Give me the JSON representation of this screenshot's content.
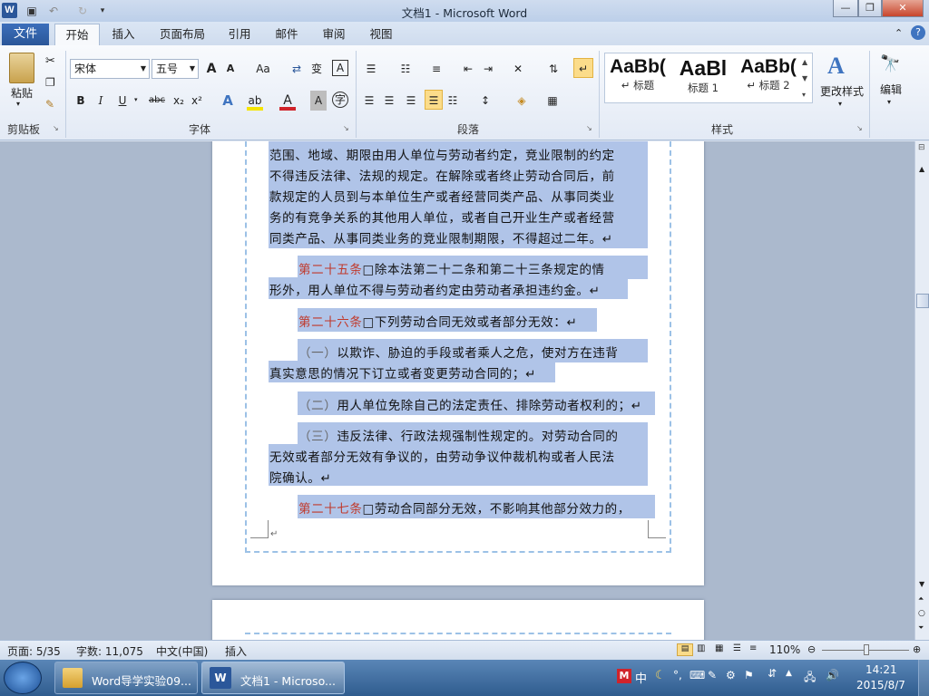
{
  "window": {
    "title": "文档1 - Microsoft Word"
  },
  "tabs": [
    "文件",
    "开始",
    "插入",
    "页面布局",
    "引用",
    "邮件",
    "审阅",
    "视图"
  ],
  "ribbon": {
    "clipboard": {
      "paste": "粘贴",
      "label": "剪贴板"
    },
    "font": {
      "name": "宋体",
      "size": "五号",
      "label": "字体",
      "grow": "A",
      "shrink": "A",
      "case": "Aa",
      "bold": "B",
      "italic": "I",
      "underline": "U",
      "strike": "abc",
      "sub": "x₂",
      "sup": "x²",
      "clear": "A"
    },
    "paragraph": {
      "label": "段落"
    },
    "styles": {
      "label": "样式",
      "items": [
        {
          "preview": "AaBb(",
          "name": "↵ 标题"
        },
        {
          "preview": "AaBl",
          "name": "标题 1"
        },
        {
          "preview": "AaBb(",
          "name": "↵ 标题 2"
        }
      ],
      "change": "更改样式"
    },
    "editing": {
      "label": "编辑"
    }
  },
  "document": {
    "lines": [
      "范围、地域、期限由用人单位与劳动者约定，竞业限制的约定",
      "不得违反法律、法规的规定。在解除或者终止劳动合同后，前",
      "款规定的人员到与本单位生产或者经营同类产品、从事同类业",
      "务的有竞争关系的其他用人单位，或者自己开业生产或者经营",
      "同类产品、从事同类业务的竞业限制期限，不得超过二年。↵"
    ],
    "art25": {
      "num": "第二十五条",
      "rest1": "除本法第二十二条和第二十三条规定的情",
      "line2": "形外，用人单位不得与劳动者约定由劳动者承担违约金。↵"
    },
    "art26": {
      "num": "第二十六条",
      "rest": "下列劳动合同无效或者部分无效：↵"
    },
    "item1": {
      "num": "（一）",
      "rest1": "以欺诈、胁迫的手段或者乘人之危，使对方在违背",
      "line2": "真实意思的情况下订立或者变更劳动合同的；↵"
    },
    "item2": {
      "num": "（二）",
      "rest": "用人单位免除自己的法定责任、排除劳动者权利的；↵"
    },
    "item3": {
      "num": "（三）",
      "rest1": "违反法律、行政法规强制性规定的。对劳动合同的",
      "line2": "无效或者部分无效有争议的，由劳动争议仲裁机构或者人民法",
      "line3": "院确认。↵"
    },
    "art27": {
      "num": "第二十七条",
      "rest": "劳动合同部分无效，不影响其他部分效力的，"
    }
  },
  "status": {
    "page": "页面: 5/35",
    "words": "字数: 11,075",
    "lang": "中文(中国)",
    "mode": "插入",
    "zoom": "110%"
  },
  "taskbar": {
    "item1": "Word导学实验09...",
    "item2": "文档1 - Microso...",
    "ime": "中",
    "time": "14:21",
    "date": "2015/8/7"
  }
}
